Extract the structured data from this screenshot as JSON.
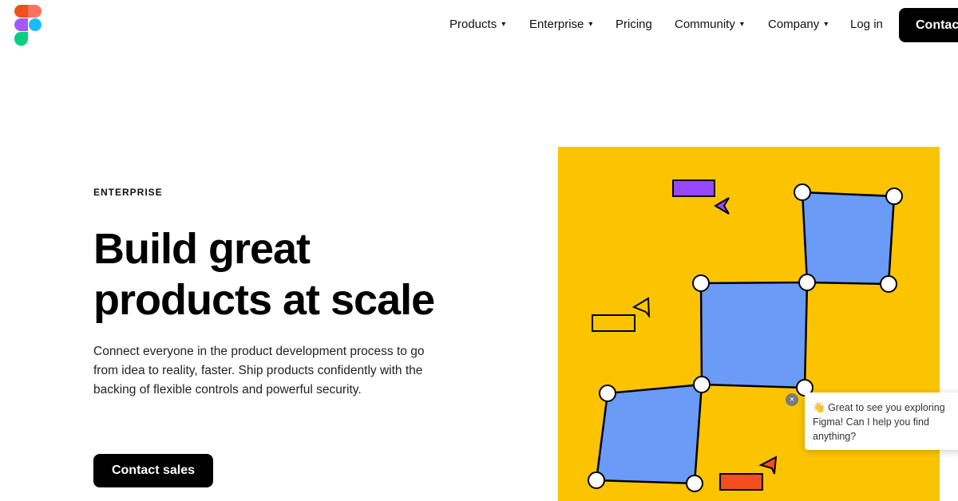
{
  "nav": {
    "items": [
      {
        "label": "Products",
        "caret": "▾"
      },
      {
        "label": "Enterprise",
        "caret": "▾"
      },
      {
        "label": "Pricing",
        "caret": ""
      },
      {
        "label": "Community",
        "caret": "▾"
      },
      {
        "label": "Company",
        "caret": "▾"
      },
      {
        "label": "Log in",
        "caret": ""
      }
    ],
    "contact_label": "Contact"
  },
  "hero": {
    "eyebrow": "ENTERPRISE",
    "headline_line1": "Build great",
    "headline_line2": "products at scale",
    "description": "Connect everyone in the product development process to go from idea to reality, faster. Ship products confidently with the backing of flexible controls and powerful security.",
    "cta_label": "Contact sales"
  },
  "chat": {
    "emoji": "👋",
    "message": "Great to see you exploring Figma! Can I help you find anything?",
    "close_glyph": "×"
  },
  "colors": {
    "art_background": "#fcc400",
    "square_fill": "#699bf7",
    "purple_tag": "#9747ff",
    "orange_tag": "#f24e1e",
    "button": "#000000"
  }
}
